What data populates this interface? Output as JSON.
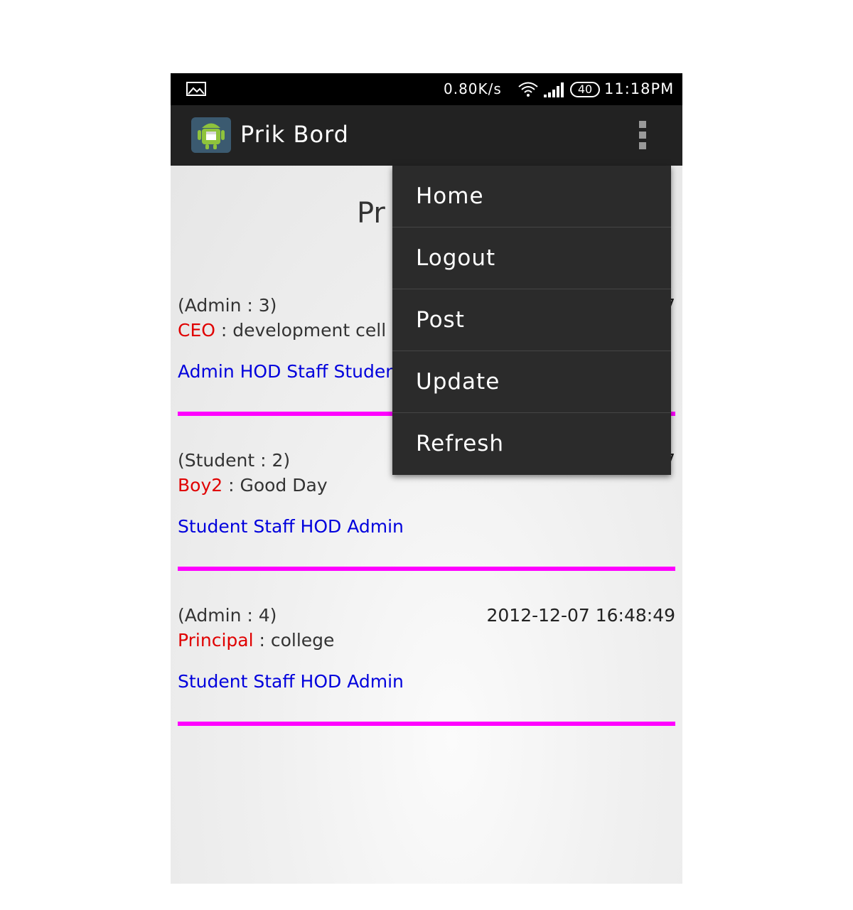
{
  "status_bar": {
    "speed": "0.80K/s",
    "battery": "40",
    "time": "11:18PM"
  },
  "action_bar": {
    "title": "Prik Bord"
  },
  "page": {
    "heading_partial": "Pr"
  },
  "posts": [
    {
      "meta": "(Admin : 3)",
      "date_partial": "7",
      "author": "CEO",
      "text": " : development cell",
      "audience": "Admin HOD Staff Studen"
    },
    {
      "meta": "(Student : 2)",
      "date_partial": "7",
      "author": "Boy2",
      "text": " : Good Day",
      "audience": "Student Staff HOD Admin"
    },
    {
      "meta": "(Admin : 4)",
      "date": "2012-12-07 16:48:49",
      "author": "Principal",
      "text": " : college",
      "audience": "Student Staff HOD Admin"
    }
  ],
  "menu": {
    "items": [
      "Home",
      "Logout",
      "Post",
      "Update",
      "Refresh"
    ]
  },
  "colors": {
    "author": "#e00000",
    "audience": "#0000dd",
    "divider": "#ff00ff",
    "action_bar": "#222222",
    "menu_bg": "#2b2b2b"
  }
}
